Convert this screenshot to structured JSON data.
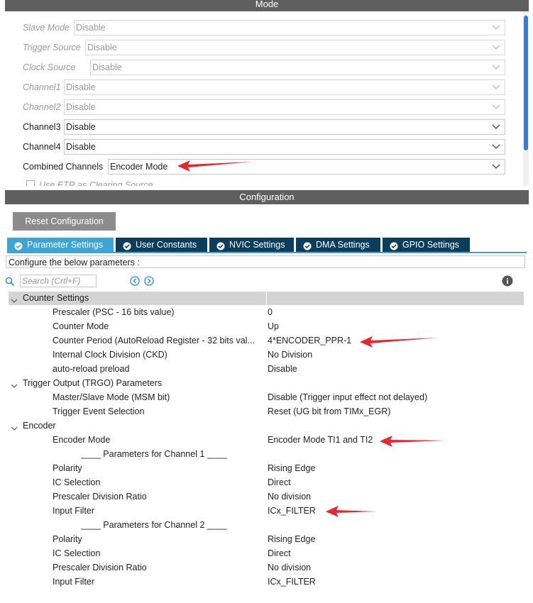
{
  "mode": {
    "header": "Mode",
    "rows": [
      {
        "label": "Slave Mode",
        "value": "Disable",
        "disabled": true
      },
      {
        "label": "Trigger Source",
        "value": "Disable",
        "disabled": true
      },
      {
        "label": "Clock Source",
        "value": "Disable",
        "disabled": true
      },
      {
        "label": "Channel1",
        "value": "Disable",
        "disabled": true
      },
      {
        "label": "Channel2",
        "value": "Disable",
        "disabled": true
      },
      {
        "label": "Channel3",
        "value": "Disable",
        "disabled": false
      },
      {
        "label": "Channel4",
        "value": "Disable",
        "disabled": false
      },
      {
        "label": "Combined Channels",
        "value": "Encoder Mode",
        "disabled": false
      }
    ],
    "etr_checkbox_label": "Use ETR as Clearing Source"
  },
  "configuration": {
    "header": "Configuration",
    "reset_button": "Reset Configuration",
    "tabs": [
      {
        "label": "Parameter Settings",
        "active": true
      },
      {
        "label": "User Constants",
        "active": false
      },
      {
        "label": "NVIC Settings",
        "active": false
      },
      {
        "label": "DMA Settings",
        "active": false
      },
      {
        "label": "GPIO Settings",
        "active": false
      }
    ],
    "hint": "Configure the below parameters :",
    "search_placeholder": "Search (Crtl+F)",
    "groups": {
      "counter": {
        "label": "Counter Settings",
        "params": [
          {
            "name": "Prescaler (PSC - 16 bits value)",
            "value": "0"
          },
          {
            "name": "Counter Mode",
            "value": "Up"
          },
          {
            "name": "Counter Period (AutoReload Register - 32 bits val...",
            "value": "4*ENCODER_PPR-1"
          },
          {
            "name": "Internal Clock Division (CKD)",
            "value": "No Division"
          },
          {
            "name": "auto-reload preload",
            "value": "Disable"
          }
        ]
      },
      "trgo": {
        "label": "Trigger Output (TRGO) Parameters",
        "params": [
          {
            "name": "Master/Slave Mode (MSM bit)",
            "value": "Disable (Trigger input effect not delayed)"
          },
          {
            "name": "Trigger Event Selection",
            "value": "Reset (UG bit from TIMx_EGR)"
          }
        ]
      },
      "encoder": {
        "label": "Encoder",
        "params": [
          {
            "name": "Encoder Mode",
            "value": "Encoder Mode TI1 and TI2"
          },
          {
            "name": "____ Parameters for Channel 1 ____",
            "value": ""
          },
          {
            "name": "Polarity",
            "value": "Rising Edge"
          },
          {
            "name": "IC Selection",
            "value": "Direct"
          },
          {
            "name": "Prescaler Division Ratio",
            "value": "No division"
          },
          {
            "name": "Input Filter",
            "value": "ICx_FILTER"
          },
          {
            "name": "____ Parameters for Channel 2 ____",
            "value": ""
          },
          {
            "name": "Polarity",
            "value": "Rising Edge"
          },
          {
            "name": "IC Selection",
            "value": "Direct"
          },
          {
            "name": "Prescaler Division Ratio",
            "value": "No division"
          },
          {
            "name": "Input Filter",
            "value": "ICx_FILTER"
          }
        ]
      }
    }
  },
  "colors": {
    "header_bg": "#5f5f5f",
    "tab_active": "#3da4d6",
    "tab_inactive": "#0b3d5c",
    "annotation_arrow": "#e8262b"
  }
}
